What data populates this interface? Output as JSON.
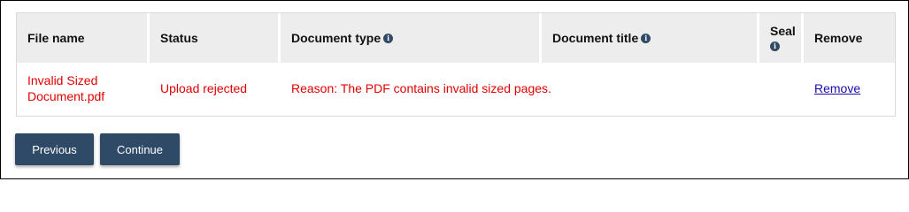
{
  "table": {
    "headers": {
      "file_name": "File name",
      "status": "Status",
      "document_type": "Document type",
      "document_title": "Document title",
      "seal": "Seal",
      "remove": "Remove"
    },
    "rows": [
      {
        "file_name": "Invalid Sized Document.pdf",
        "status": "Upload rejected",
        "document_type": "Reason: The PDF contains invalid sized pages.",
        "remove_label": "Remove"
      }
    ]
  },
  "buttons": {
    "previous": "Previous",
    "continue": "Continue"
  },
  "colors": {
    "error_text": "#e00000",
    "button_bg": "#2f4a67",
    "header_bg": "#ededed",
    "link": "#1a0dab"
  },
  "icons": {
    "info": "info-icon"
  }
}
